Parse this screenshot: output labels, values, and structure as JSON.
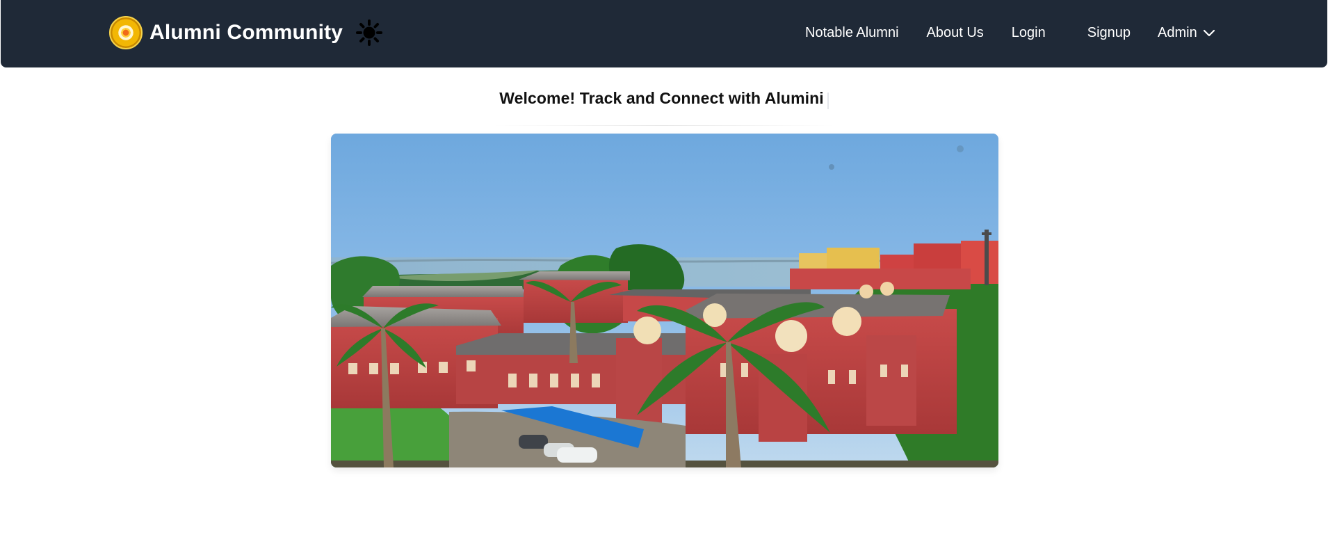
{
  "navbar": {
    "brand": "Alumni Community",
    "logo": "circular-college-emblem",
    "theme_icon": "sun-icon",
    "links": {
      "notable_alumni": "Notable Alumni",
      "about_us": "About Us",
      "login": "Login",
      "signup": "Signup",
      "admin": "Admin"
    },
    "admin_icon": "chevron-down-icon"
  },
  "main": {
    "welcome": "Welcome! Track and Connect with Alumini",
    "hero_image": "campus-aerial-photo"
  },
  "colors": {
    "navbar": "#1f2937",
    "page_background": "#ffffff",
    "text": "#111111"
  }
}
